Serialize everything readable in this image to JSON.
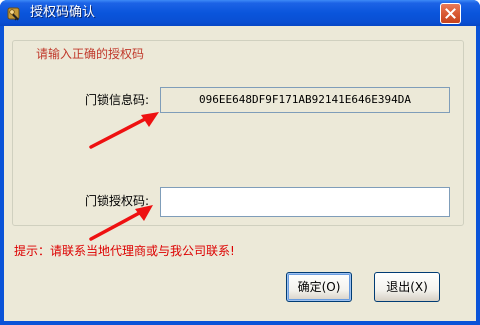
{
  "window": {
    "title": "授权码确认",
    "icon": "key-app-icon",
    "close_icon": "close-icon"
  },
  "group": {
    "title": "请输入正确的授权码"
  },
  "fields": {
    "lock_info_label": "门锁信息码:",
    "lock_info_value": "096EE648DF9F171AB92141E646E394DA",
    "auth_code_label": "门锁授权码:",
    "auth_code_value": ""
  },
  "hint": "提示：请联系当地代理商或与我公司联系!",
  "buttons": {
    "ok": "确定(O)",
    "exit": "退出(X)"
  },
  "colors": {
    "title_bar": "#0a55dc",
    "client_bg": "#ece9d8",
    "accent_red": "#dd0000",
    "arrow_red": "#ee1111"
  }
}
